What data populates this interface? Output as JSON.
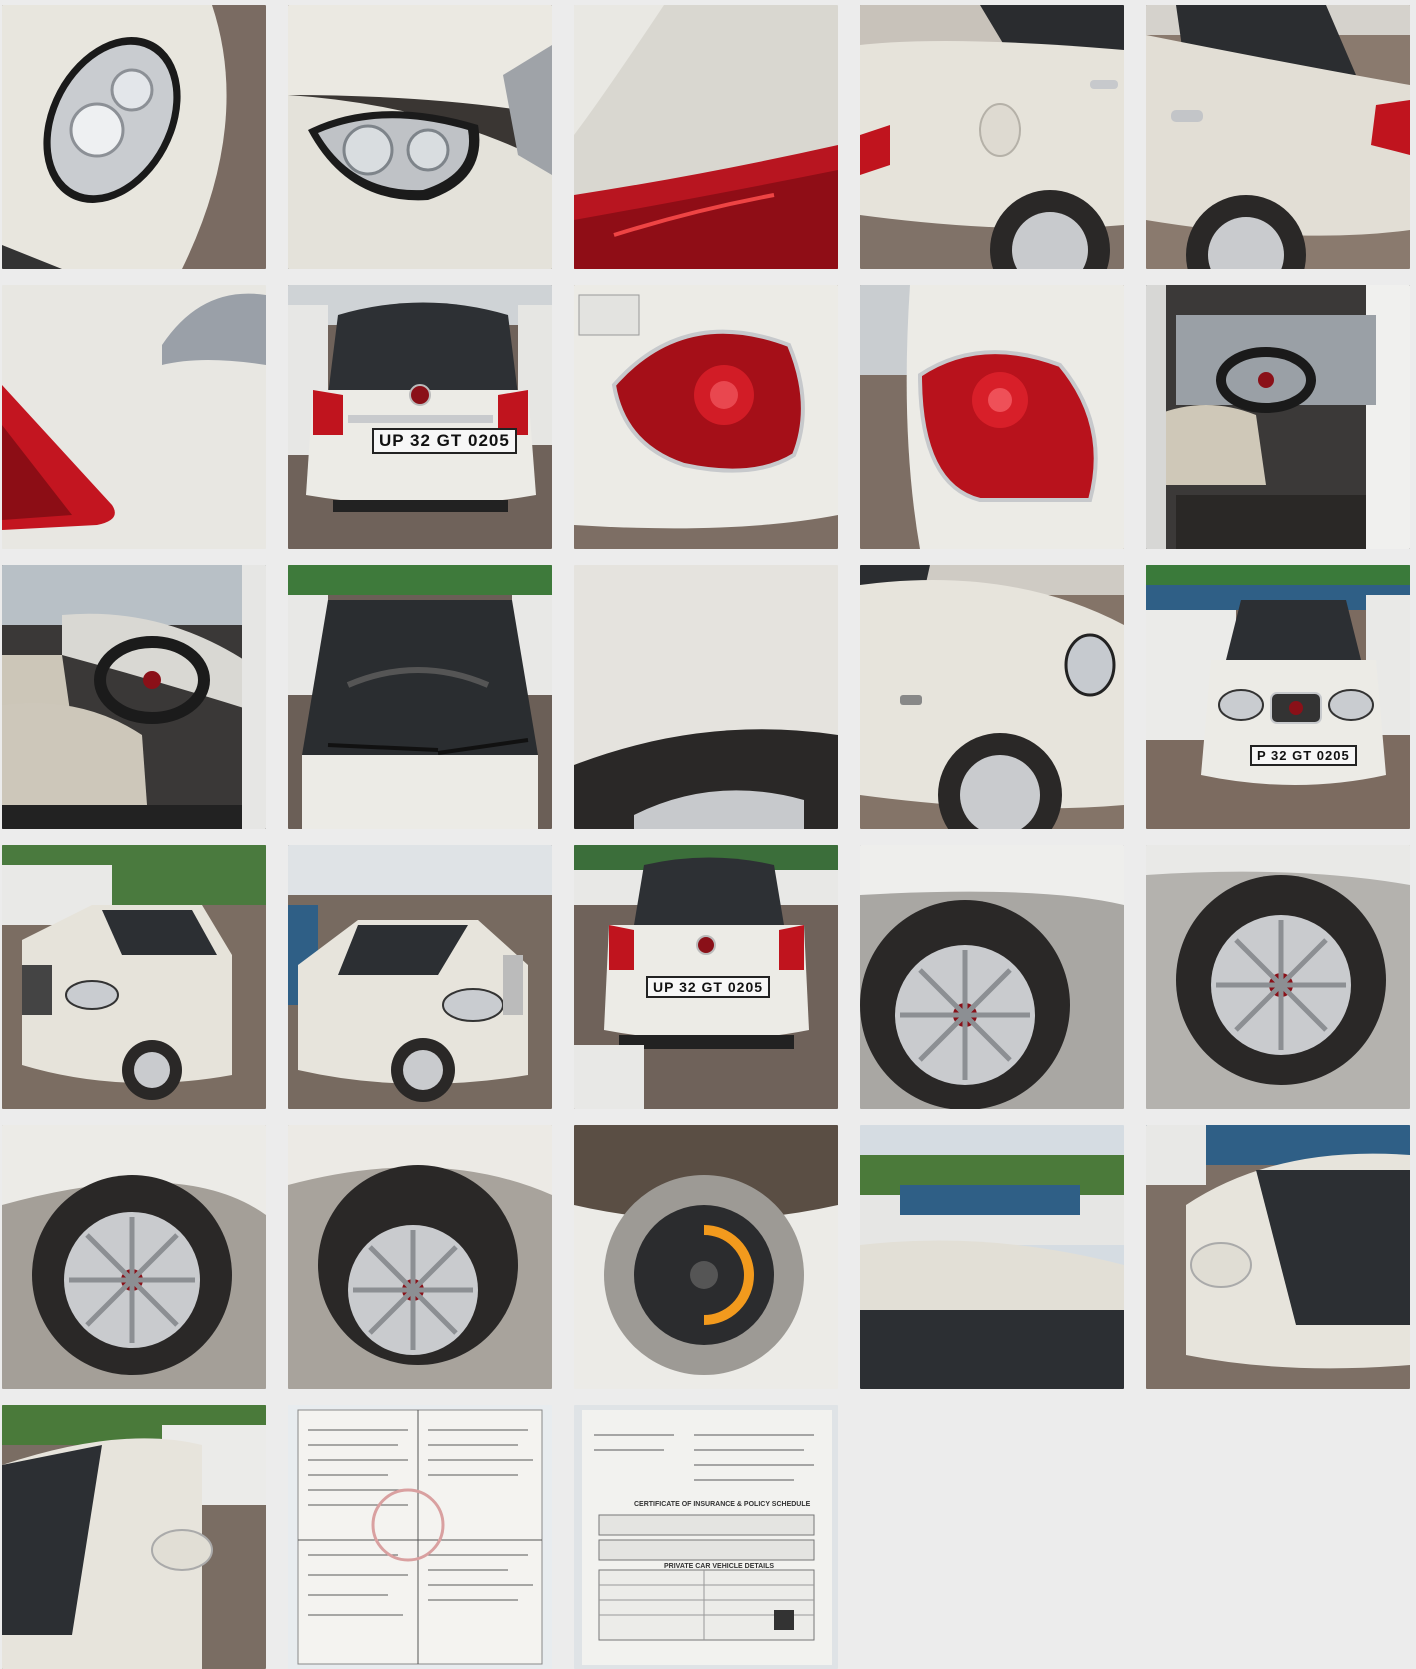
{
  "gallery": {
    "columns": 5,
    "photos": [
      {
        "subject": "headlight-left"
      },
      {
        "subject": "headlight-right"
      },
      {
        "subject": "tail-lamp-top"
      },
      {
        "subject": "side-rear-door"
      },
      {
        "subject": "side-rear-quarter"
      },
      {
        "subject": "rear-quarter-closeup"
      },
      {
        "subject": "rear-view"
      },
      {
        "subject": "tail-lamp-left"
      },
      {
        "subject": "tail-lamp-right"
      },
      {
        "subject": "interior-driver"
      },
      {
        "subject": "interior-dashboard"
      },
      {
        "subject": "windshield"
      },
      {
        "subject": "fender-panel"
      },
      {
        "subject": "front-fender-wheel"
      },
      {
        "subject": "front-view"
      },
      {
        "subject": "front-left-angle"
      },
      {
        "subject": "front-right-angle"
      },
      {
        "subject": "rear-view-yard"
      },
      {
        "subject": "wheel-front-left"
      },
      {
        "subject": "wheel-front-right"
      },
      {
        "subject": "wheel-rear-left"
      },
      {
        "subject": "wheel-rear-right"
      },
      {
        "subject": "spare-wheel"
      },
      {
        "subject": "roof"
      },
      {
        "subject": "side-mirror-right"
      },
      {
        "subject": "side-mirror-left"
      },
      {
        "subject": "registration-document"
      },
      {
        "subject": "insurance-certificate"
      }
    ]
  },
  "plates": {
    "rear": "UP 32 GT 0205",
    "front_partial": "P 32 GT 0205"
  },
  "documents": {
    "insurance_heading": "CERTIFICATE OF INSURANCE & POLICY SCHEDULE",
    "insurance_section": "PRIVATE CAR VEHICLE DETAILS"
  },
  "colors": {
    "background": "#ececec",
    "car_white": "#e9e6dc",
    "tail_red": "#c0141e",
    "pavement": "#8a7a6e",
    "tyre": "#2a2827"
  }
}
